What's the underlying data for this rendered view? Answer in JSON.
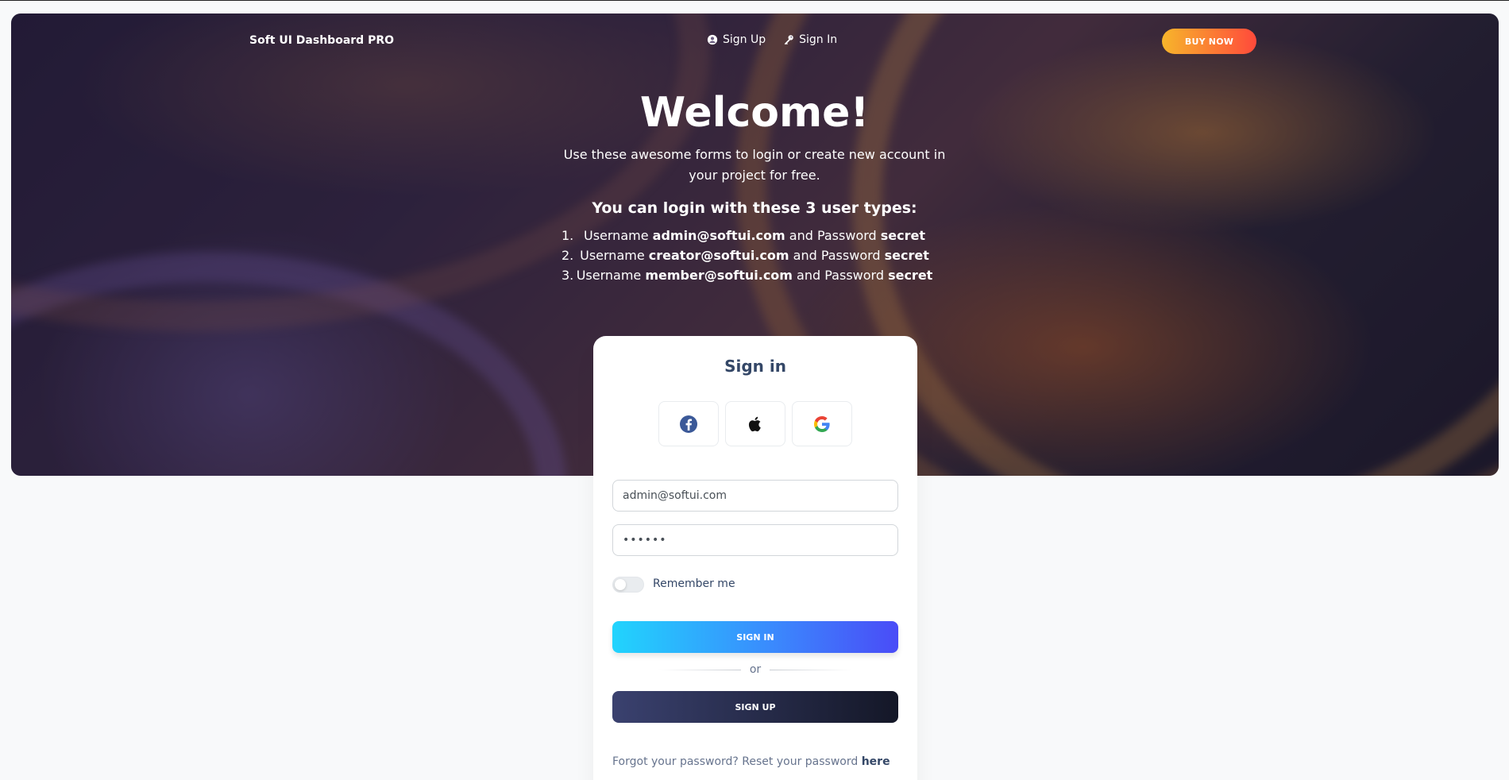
{
  "navbar": {
    "brand": "Soft UI Dashboard PRO",
    "links": [
      {
        "label": "Sign Up",
        "icon": "user-circle-icon"
      },
      {
        "label": "Sign In",
        "icon": "key-icon"
      }
    ],
    "buy_label": "BUY NOW"
  },
  "hero": {
    "title": "Welcome!",
    "subtitle": "Use these awesome forms to login or create new account in your project for free.",
    "heading": "You can login with these 3 user types:",
    "users": [
      {
        "num": "1.",
        "prefix": "Username ",
        "username": "admin@softui.com",
        "mid": " and Password ",
        "password": "secret"
      },
      {
        "num": "2.",
        "prefix": "Username ",
        "username": "creator@softui.com",
        "mid": " and Password ",
        "password": "secret"
      },
      {
        "num": "3.",
        "prefix": "Username ",
        "username": "member@softui.com",
        "mid": " and Password ",
        "password": "secret"
      }
    ]
  },
  "card": {
    "title": "Sign in",
    "social": [
      "facebook-icon",
      "apple-icon",
      "google-icon"
    ],
    "email_value": "admin@softui.com",
    "password_value": "••••••",
    "remember_label": "Remember me",
    "remember_checked": false,
    "signin_label": "SIGN IN",
    "or_label": "or",
    "signup_label": "SIGN UP",
    "forgot_prefix": "Forgot your password? Reset your password ",
    "forgot_link": "here"
  },
  "colors": {
    "accent_gradient": [
      "#21d4fd",
      "#4a4cf7"
    ],
    "buy_gradient": [
      "#f7b52b",
      "#ff4a3b"
    ],
    "dark_gradient": [
      "#3a416f",
      "#141727"
    ]
  }
}
